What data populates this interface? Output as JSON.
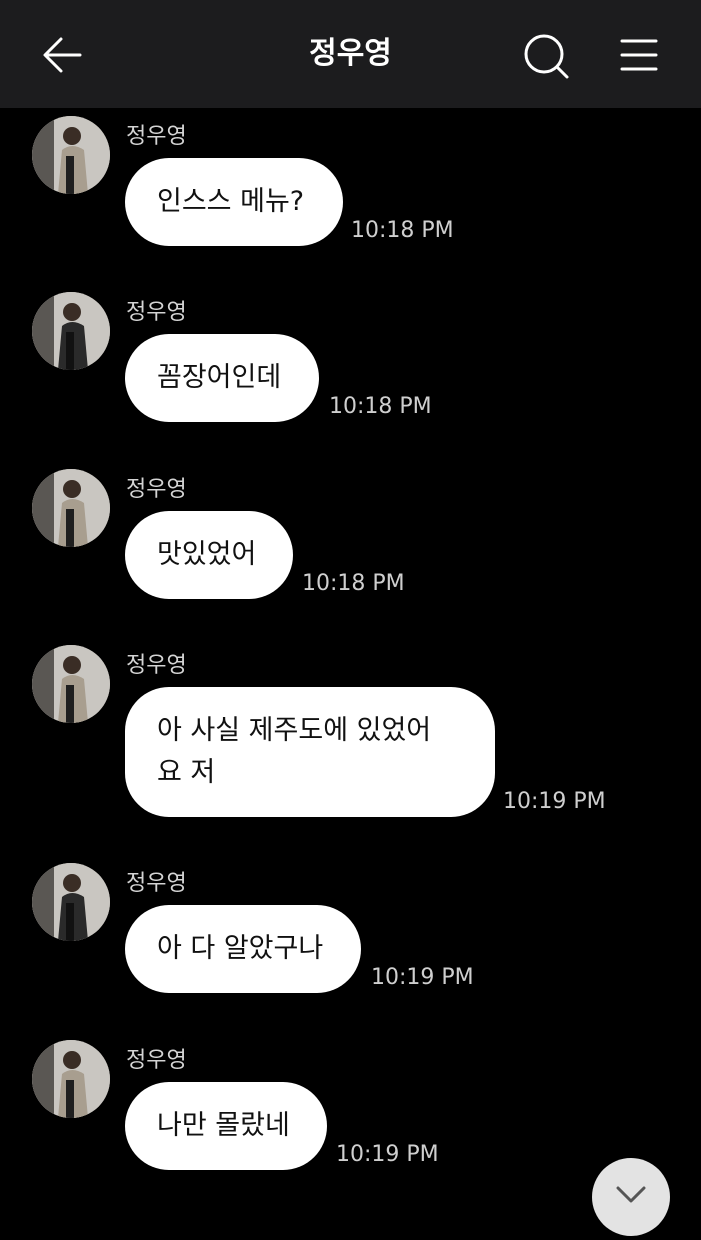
{
  "header": {
    "title": "정우영",
    "back_icon": "arrow-left-icon",
    "search_icon": "search-icon",
    "menu_icon": "hamburger-menu-icon",
    "background": "#1c1c1e"
  },
  "messages": [
    {
      "sender": "정우영",
      "text": "인스스 메뉴?",
      "time": "10:18 PM"
    },
    {
      "sender": "정우영",
      "text": "꼼장어인데",
      "time": "10:18 PM"
    },
    {
      "sender": "정우영",
      "text": "맛있었어",
      "time": "10:18 PM"
    },
    {
      "sender": "정우영",
      "lines": [
        "아 사실 제주도에 있었어",
        "요 저"
      ],
      "time": "10:19 PM"
    },
    {
      "sender": "정우영",
      "text": "아 다 알았구나",
      "time": "10:19 PM"
    },
    {
      "sender": "정우영",
      "text": "나만 몰랐네",
      "time": "10:19 PM"
    }
  ],
  "scroll_down_icon": "chevron-down-icon",
  "colors": {
    "background": "#000000",
    "bubble": "#ffffff",
    "bubble_text": "#111111",
    "meta_text": "#cfcfcf"
  }
}
